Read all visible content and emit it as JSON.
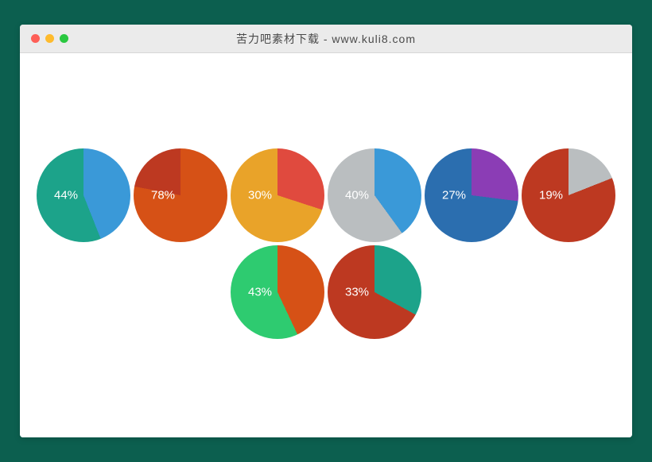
{
  "window": {
    "title": "苦力吧素材下载 - www.kuli8.com"
  },
  "chart_data": [
    {
      "type": "pie",
      "value": 44,
      "label": "44%",
      "colorA": "#1ca38a",
      "colorB": "#3a99d8"
    },
    {
      "type": "pie",
      "value": 78,
      "label": "78%",
      "colorA": "#bd3921",
      "colorB": "#d65116"
    },
    {
      "type": "pie",
      "value": 30,
      "label": "30%",
      "colorA": "#e9a329",
      "colorB": "#e04a3e"
    },
    {
      "type": "pie",
      "value": 40,
      "label": "40%",
      "colorA": "#babec0",
      "colorB": "#3a99d8"
    },
    {
      "type": "pie",
      "value": 27,
      "label": "27%",
      "colorA": "#2b6eaf",
      "colorB": "#8b3db5"
    },
    {
      "type": "pie",
      "value": 19,
      "label": "19%",
      "colorA": "#bd3921",
      "colorB": "#babec0"
    },
    {
      "type": "pie",
      "value": 43,
      "label": "43%",
      "colorA": "#2ecb70",
      "colorB": "#d65116"
    },
    {
      "type": "pie",
      "value": 33,
      "label": "33%",
      "colorA": "#bd3921",
      "colorB": "#1ca38a"
    }
  ]
}
